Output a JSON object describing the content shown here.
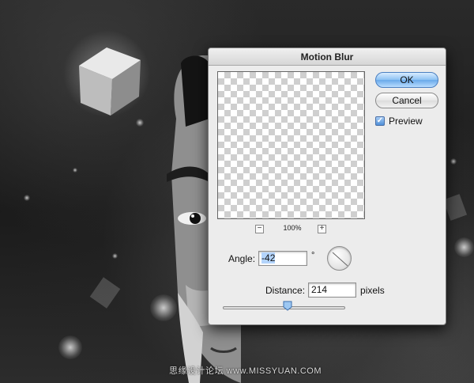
{
  "dialog": {
    "title": "Motion Blur",
    "ok_label": "OK",
    "cancel_label": "Cancel",
    "preview_label": "Preview",
    "preview_checked": true,
    "zoom_level": "100%",
    "zoom_out_symbol": "−",
    "zoom_in_symbol": "+",
    "angle_label": "Angle:",
    "angle_value": "-42",
    "angle_unit": "°",
    "distance_label": "Distance:",
    "distance_value": "214",
    "distance_unit": "pixels",
    "distance_slider_fraction": 0.53
  },
  "background": {
    "watermark": "思缘设计论坛 www.MISSYUAN.COM"
  },
  "colors": {
    "default_button": "#6aa9ea",
    "dialog_bg": "#ececec"
  },
  "icons": {
    "checkbox": "checkmark-icon",
    "dial": "angle-dial-icon",
    "thumb": "slider-thumb-icon"
  }
}
